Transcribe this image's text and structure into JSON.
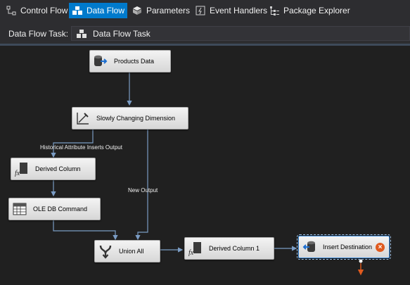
{
  "tabs": [
    {
      "label": "Control Flow",
      "icon": "control-flow-icon",
      "active": false
    },
    {
      "label": "Data Flow",
      "icon": "data-flow-icon",
      "active": true
    },
    {
      "label": "Parameters",
      "icon": "parameters-icon",
      "active": false
    },
    {
      "label": "Event Handlers",
      "icon": "event-handlers-icon",
      "active": false
    },
    {
      "label": "Package Explorer",
      "icon": "package-explorer-icon",
      "active": false
    }
  ],
  "task": {
    "label": "Data Flow Task:",
    "value": "Data Flow Task"
  },
  "components": {
    "products_data": "Products Data",
    "scd": "Slowly Changing Dimension",
    "derived_column": "Derived Column",
    "ole_db_command": "OLE DB Command",
    "union_all": "Union All",
    "derived_column_1": "Derived Column 1",
    "insert_destination": "Insert Destination"
  },
  "paths": {
    "historical": "Historical Attribute Inserts Output",
    "new_output": "New Output"
  },
  "colors": {
    "active_tab": "#007acc",
    "canvas": "#202020",
    "wire": "#7a9cc4",
    "error": "#e05a1e"
  }
}
